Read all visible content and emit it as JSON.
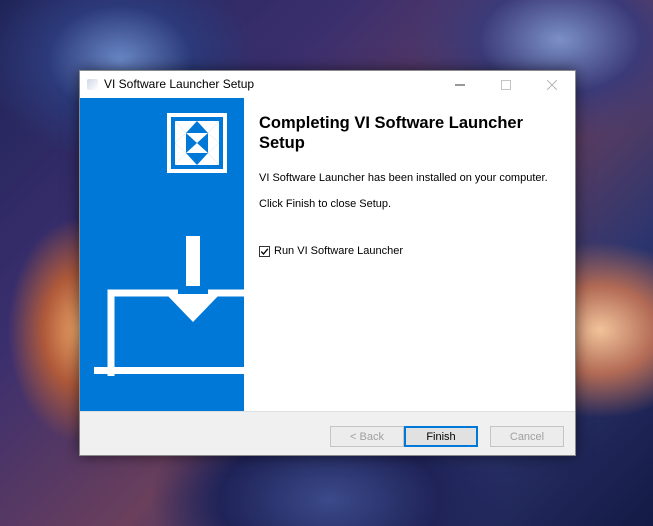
{
  "window": {
    "title": "VI Software Launcher Setup",
    "controls": {
      "minimize_icon": "minimize-icon",
      "maximize_icon": "maximize-icon",
      "close_icon": "close-icon"
    }
  },
  "content": {
    "heading": "Completing VI Software Launcher Setup",
    "installed_text": "VI Software Launcher has been installed on your computer.",
    "finish_text": "Click Finish to close Setup.",
    "run_checkbox": {
      "label": "Run VI Software Launcher",
      "checked": true
    }
  },
  "buttons": {
    "back": "< Back",
    "finish": "Finish",
    "cancel": "Cancel"
  },
  "colors": {
    "accent": "#0078d7",
    "sidebar": "#0078d7"
  }
}
